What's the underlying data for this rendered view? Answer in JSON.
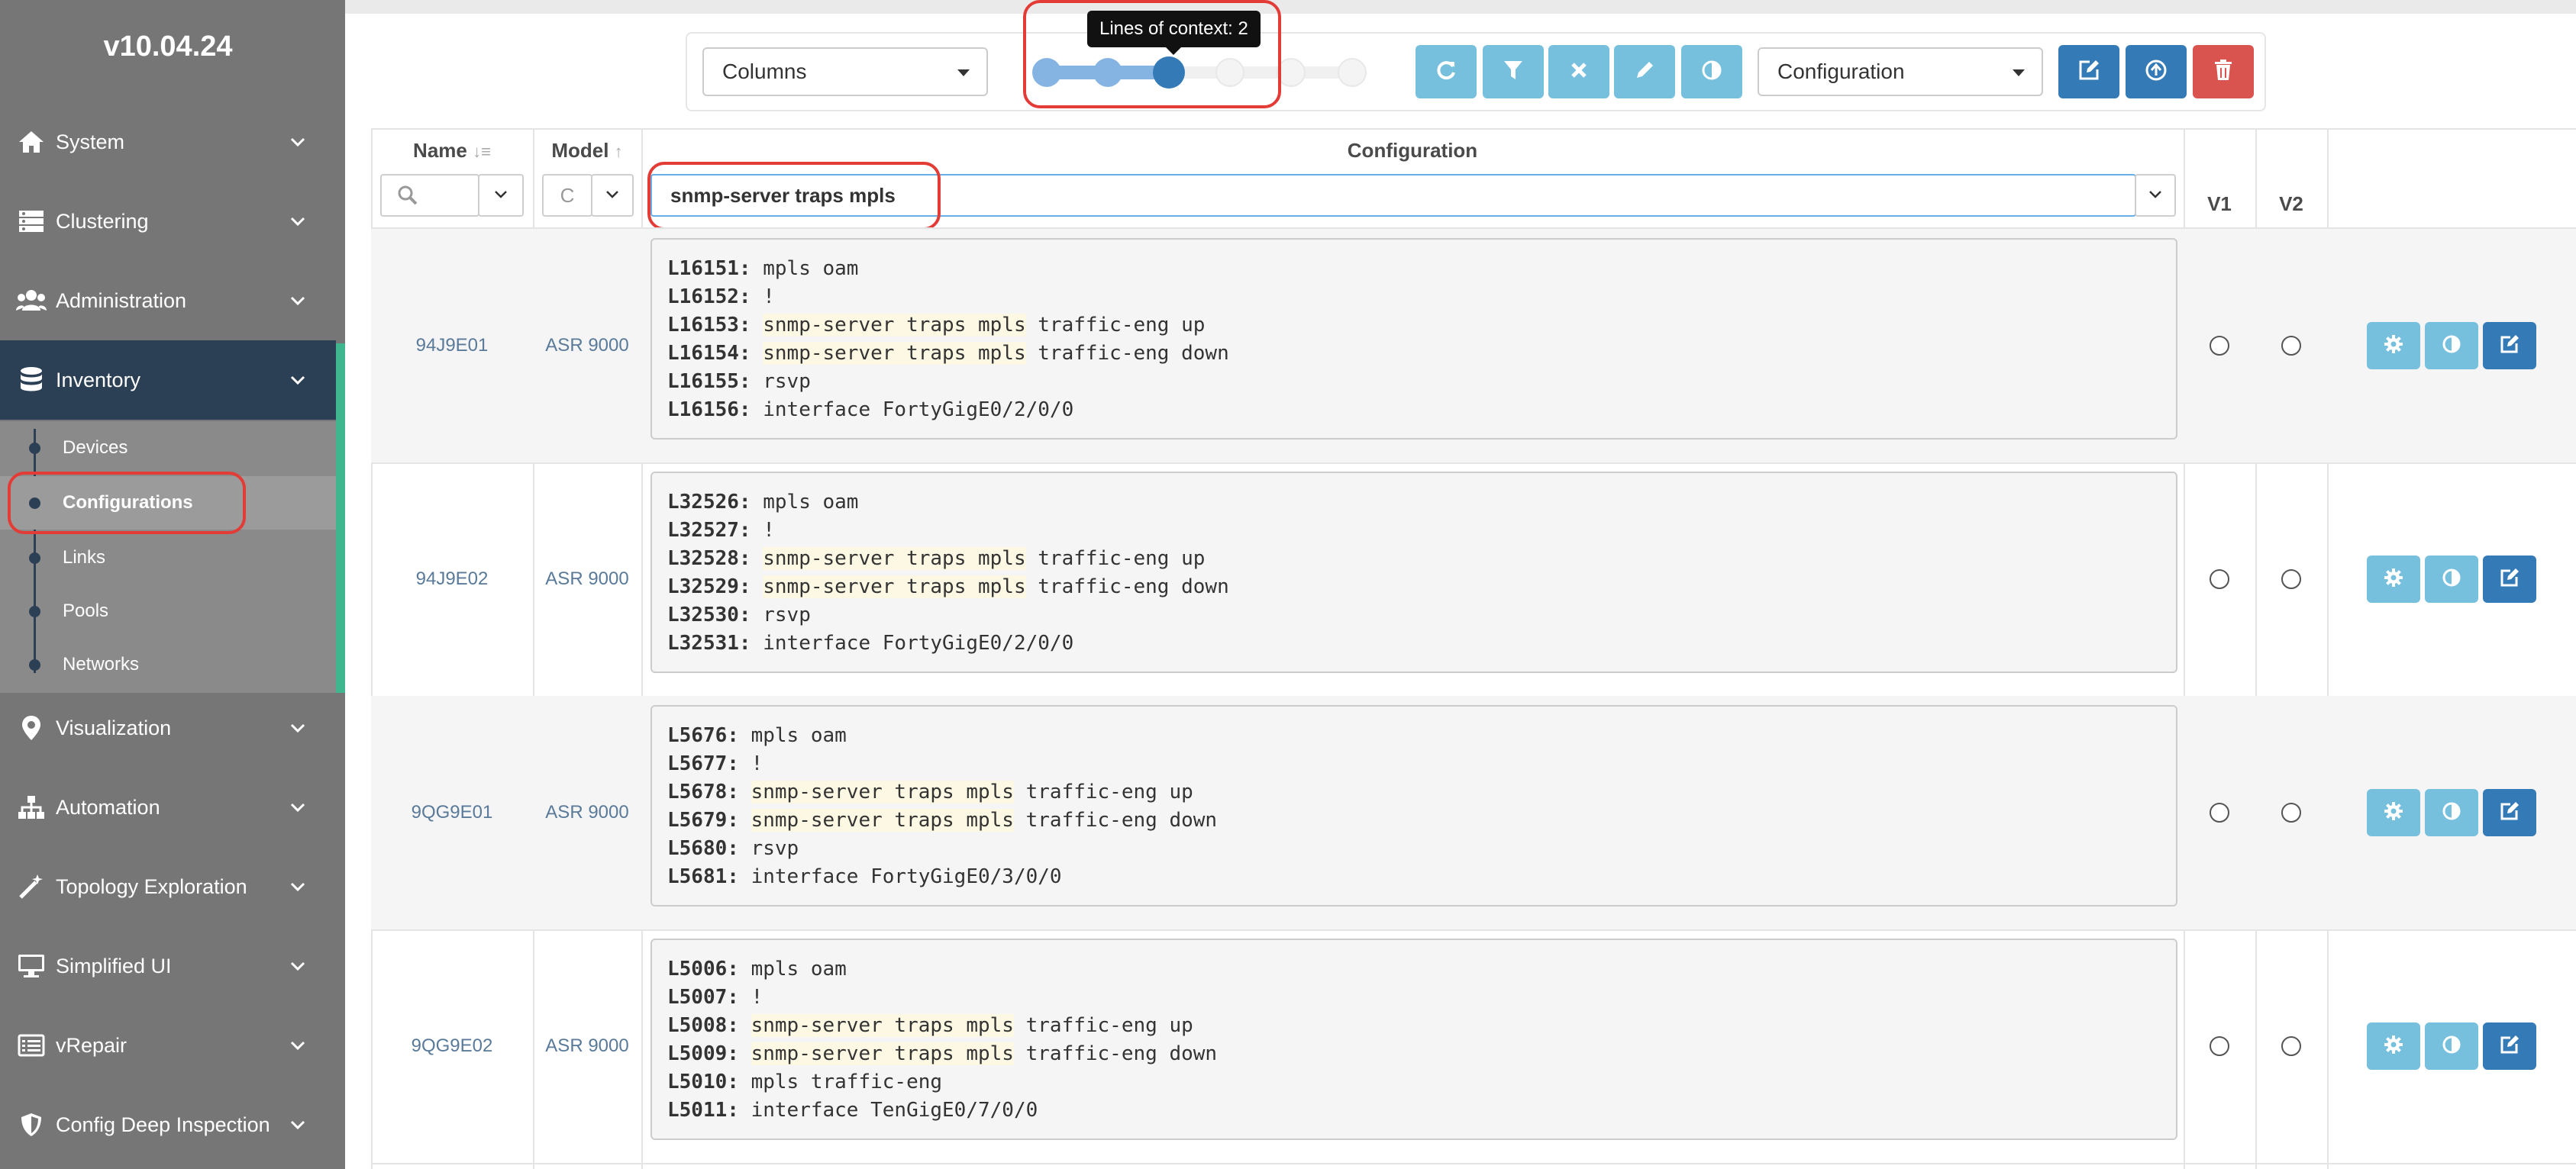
{
  "app": {
    "version": "v10.04.24"
  },
  "sidebar": {
    "items": [
      {
        "label": "System",
        "icon": "home-icon"
      },
      {
        "label": "Clustering",
        "icon": "server-icon"
      },
      {
        "label": "Administration",
        "icon": "users-icon"
      },
      {
        "label": "Inventory",
        "icon": "database-icon",
        "active": true
      },
      {
        "label": "Visualization",
        "icon": "map-marker-icon"
      },
      {
        "label": "Automation",
        "icon": "sitemap-icon"
      },
      {
        "label": "Topology Exploration",
        "icon": "magic-wand-icon"
      },
      {
        "label": "Simplified UI",
        "icon": "desktop-icon"
      },
      {
        "label": "vRepair",
        "icon": "list-icon"
      },
      {
        "label": "Config Deep Inspection",
        "icon": "shield-icon"
      }
    ],
    "inventory_subitems": [
      {
        "label": "Devices"
      },
      {
        "label": "Configurations",
        "selected": true
      },
      {
        "label": "Links"
      },
      {
        "label": "Pools"
      },
      {
        "label": "Networks"
      }
    ]
  },
  "toolbar": {
    "columns_select": "Columns",
    "context_slider": {
      "tooltip": "Lines of context: 2",
      "value": 2,
      "max": 5
    },
    "search_mode_select": "Configuration",
    "buttons": [
      "refresh-icon",
      "filter-icon",
      "clear-icon",
      "edit-icon",
      "contrast-icon"
    ],
    "right_buttons": [
      "edit-icon",
      "upload-icon",
      "trash-icon"
    ]
  },
  "table": {
    "headers": {
      "name": "Name",
      "model": "Model",
      "configuration": "Configuration",
      "v1": "V1",
      "v2": "V2"
    },
    "filters": {
      "model_value": "C",
      "configuration_value": "snmp-server traps mpls"
    },
    "rows": [
      {
        "name": "94J9E01",
        "model": "ASR 9000",
        "lines": [
          {
            "num": "L16151:",
            "text": " mpls oam",
            "match": false
          },
          {
            "num": "L16152:",
            "text": " !",
            "match": false
          },
          {
            "num": "L16153:",
            "text": " traffic-eng up",
            "match": true
          },
          {
            "num": "L16154:",
            "text": " traffic-eng down",
            "match": true
          },
          {
            "num": "L16155:",
            "text": " rsvp",
            "match": false
          },
          {
            "num": "L16156:",
            "text": " interface FortyGigE0/2/0/0",
            "match": false
          }
        ]
      },
      {
        "name": "94J9E02",
        "model": "ASR 9000",
        "lines": [
          {
            "num": "L32526:",
            "text": " mpls oam",
            "match": false
          },
          {
            "num": "L32527:",
            "text": " !",
            "match": false
          },
          {
            "num": "L32528:",
            "text": " traffic-eng up",
            "match": true
          },
          {
            "num": "L32529:",
            "text": " traffic-eng down",
            "match": true
          },
          {
            "num": "L32530:",
            "text": " rsvp",
            "match": false
          },
          {
            "num": "L32531:",
            "text": " interface FortyGigE0/2/0/0",
            "match": false
          }
        ]
      },
      {
        "name": "9QG9E01",
        "model": "ASR 9000",
        "lines": [
          {
            "num": "L5676:",
            "text": " mpls oam",
            "match": false
          },
          {
            "num": "L5677:",
            "text": " !",
            "match": false
          },
          {
            "num": "L5678:",
            "text": " traffic-eng up",
            "match": true
          },
          {
            "num": "L5679:",
            "text": " traffic-eng down",
            "match": true
          },
          {
            "num": "L5680:",
            "text": " rsvp",
            "match": false
          },
          {
            "num": "L5681:",
            "text": " interface FortyGigE0/3/0/0",
            "match": false
          }
        ]
      },
      {
        "name": "9QG9E02",
        "model": "ASR 9000",
        "lines": [
          {
            "num": "L5006:",
            "text": " mpls oam",
            "match": false
          },
          {
            "num": "L5007:",
            "text": " !",
            "match": false
          },
          {
            "num": "L5008:",
            "text": " traffic-eng up",
            "match": true
          },
          {
            "num": "L5009:",
            "text": " traffic-eng down",
            "match": true
          },
          {
            "num": "L5010:",
            "text": " mpls traffic-eng",
            "match": false
          },
          {
            "num": "L5011:",
            "text": " interface TenGigE0/7/0/0",
            "match": false
          }
        ]
      }
    ]
  },
  "colors": {
    "sidebar": "#767676",
    "active": "#2b3f55",
    "accent_green": "#3fb68e",
    "highlight_red": "#e33b36",
    "btn_light": "#76c0dd",
    "btn_dark": "#337ab7",
    "btn_danger": "#d9534f"
  }
}
